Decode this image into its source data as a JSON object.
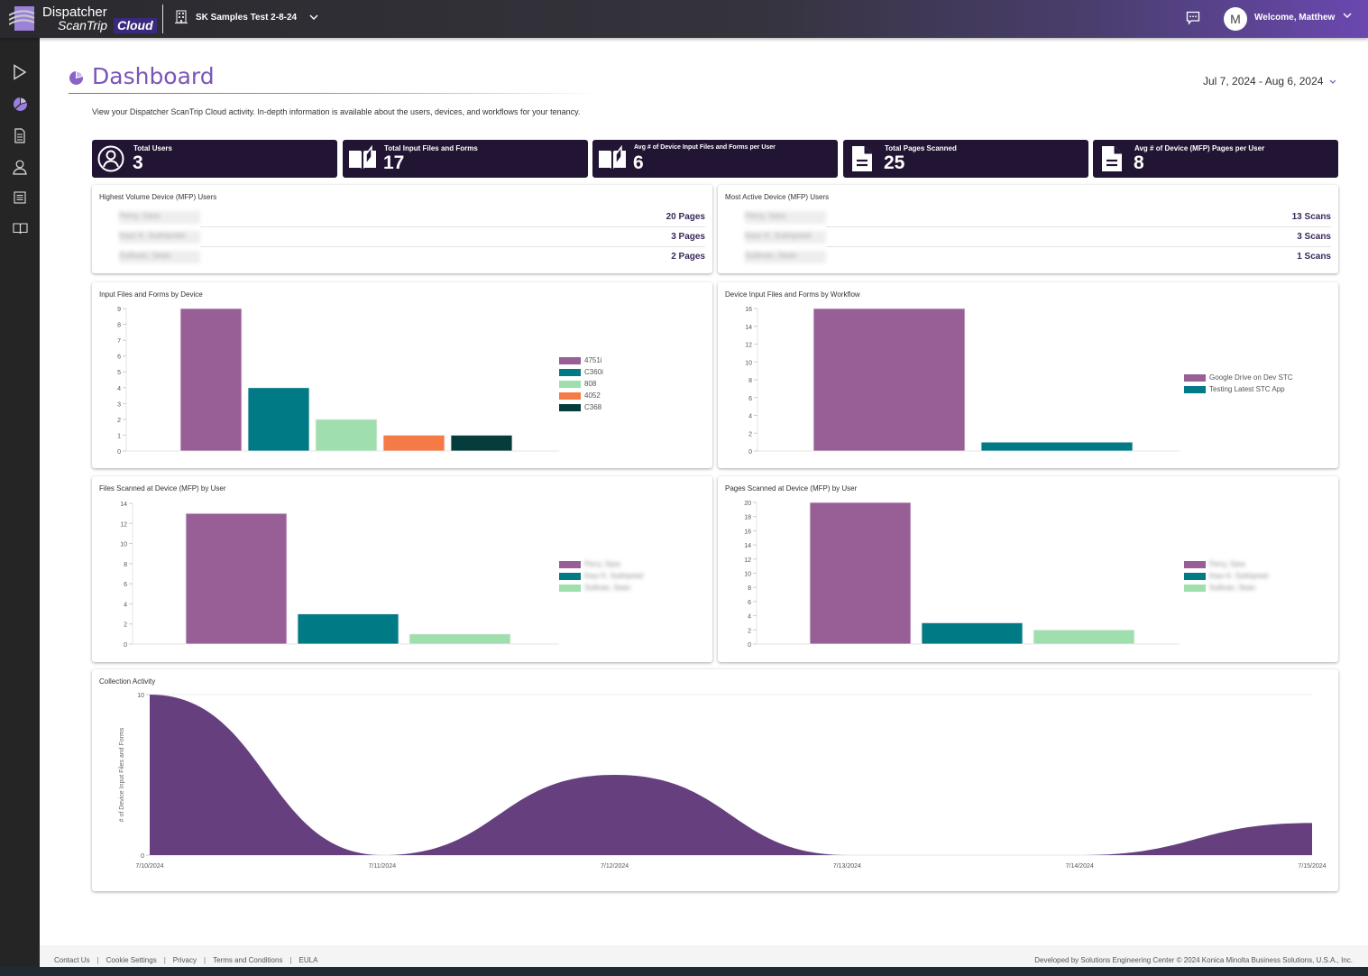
{
  "app": {
    "logo_line1": "Dispatcher",
    "logo_line2": "ScanTrip",
    "logo_badge": "Cloud",
    "tenant_name": "SK Samples Test 2-8-24",
    "avatar_initial": "M",
    "welcome_text": "Welcome, Matthew"
  },
  "colors": {
    "accent": "#7a55b8",
    "stat_bg": "#221433",
    "series": [
      "#985e96",
      "#007a85",
      "#9fdfae",
      "#f47b45",
      "#063c3b"
    ],
    "area": "#663f7e"
  },
  "sidebar": {
    "items": [
      {
        "name": "play",
        "active": false
      },
      {
        "name": "dashboard",
        "active": true
      },
      {
        "name": "scan-documents",
        "active": false
      },
      {
        "name": "users",
        "active": false
      },
      {
        "name": "list",
        "active": false
      },
      {
        "name": "book",
        "active": false
      }
    ]
  },
  "page": {
    "title": "Dashboard",
    "subtitle": "View your Dispatcher ScanTrip Cloud activity. In-depth information is available about the users, devices, and workflows for your tenancy.",
    "date_range": "Jul 7, 2024 - Aug 6, 2024"
  },
  "stats": [
    {
      "label": "Total Users",
      "value": "3",
      "icon": "user-circle"
    },
    {
      "label": "Total Input Files and Forms",
      "value": "17",
      "icon": "open-book"
    },
    {
      "label": "Avg # of Device Input Files and Forms per User",
      "value": "6",
      "icon": "open-book"
    },
    {
      "label": "Total Pages Scanned",
      "value": "25",
      "icon": "document"
    },
    {
      "label": "Avg # of Device (MFP) Pages per User",
      "value": "8",
      "icon": "document"
    }
  ],
  "highest_volume": {
    "title": "Highest Volume Device (MFP) Users",
    "rows": [
      {
        "name": "Perry, Sara",
        "value": "20 Pages"
      },
      {
        "name": "Kaur K. Sukhpreet",
        "value": "3 Pages"
      },
      {
        "name": "Sullivan, Sean",
        "value": "2 Pages"
      }
    ]
  },
  "most_active": {
    "title": "Most Active Device (MFP) Users",
    "rows": [
      {
        "name": "Perry, Sara",
        "value": "13 Scans"
      },
      {
        "name": "Kaur K. Sukhpreet",
        "value": "3 Scans"
      },
      {
        "name": "Sullivan, Sean",
        "value": "1 Scans"
      }
    ]
  },
  "chart_data": [
    {
      "id": "by-device",
      "type": "bar",
      "title": "Input Files and Forms by Device",
      "categories": [
        "4751i",
        "C360i",
        "808",
        "4052",
        "C368"
      ],
      "values": [
        9,
        4,
        2,
        1,
        1
      ],
      "ylim": [
        0,
        9
      ],
      "yticks": [
        0,
        1,
        2,
        3,
        4,
        5,
        6,
        7,
        8,
        9
      ],
      "legend": "right",
      "xlabel": "",
      "ylabel": ""
    },
    {
      "id": "by-workflow",
      "type": "bar",
      "title": "Device Input Files and Forms by Workflow",
      "categories": [
        "Google Drive on Dev STC",
        "Testing Latest STC App"
      ],
      "values": [
        16,
        1
      ],
      "ylim": [
        0,
        16
      ],
      "yticks": [
        0,
        2,
        4,
        6,
        8,
        10,
        12,
        14,
        16
      ],
      "legend": "right",
      "xlabel": "",
      "ylabel": ""
    },
    {
      "id": "files-by-user",
      "type": "bar",
      "title": "Files Scanned at Device (MFP) by User",
      "categories": [
        "Perry, Sara",
        "Kaur K. Sukhpreet",
        "Sullivan, Sean"
      ],
      "values": [
        13,
        3,
        1
      ],
      "ylim": [
        0,
        14
      ],
      "yticks": [
        0,
        2,
        4,
        6,
        8,
        10,
        12,
        14
      ],
      "legend": "right",
      "legend_blurred": true,
      "xlabel": "",
      "ylabel": ""
    },
    {
      "id": "pages-by-user",
      "type": "bar",
      "title": "Pages Scanned at Device (MFP) by User",
      "categories": [
        "Perry, Sara",
        "Kaur K. Sukhpreet",
        "Sullivan, Sean"
      ],
      "values": [
        20,
        3,
        2
      ],
      "ylim": [
        0,
        20
      ],
      "yticks": [
        0,
        2,
        4,
        6,
        8,
        10,
        12,
        14,
        16,
        18,
        20
      ],
      "legend": "right",
      "legend_blurred": true,
      "xlabel": "",
      "ylabel": ""
    },
    {
      "id": "collection-activity",
      "type": "area",
      "title": "Collection Activity",
      "x": [
        "7/10/2024",
        "7/11/2024",
        "7/12/2024",
        "7/13/2024",
        "7/14/2024",
        "7/15/2024"
      ],
      "values": [
        10,
        0,
        5,
        0,
        0,
        2
      ],
      "ylim": [
        0,
        10
      ],
      "yticks": [
        0,
        10
      ],
      "xlabel": "",
      "ylabel": "# of Device Input Files and Forms",
      "grid": true
    }
  ],
  "footer": {
    "links": [
      "Contact Us",
      "Cookie Settings",
      "Privacy",
      "Terms and Conditions",
      "EULA"
    ],
    "copyright": "Developed by Solutions Engineering Center © 2024 Konica Minolta Business Solutions, U.S.A., Inc."
  }
}
